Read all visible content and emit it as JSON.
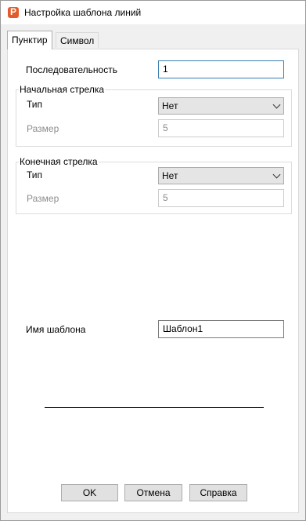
{
  "window": {
    "title": "Настройка шаблона линий",
    "icon_letter": "P"
  },
  "tabs": [
    {
      "label": "Пунктир",
      "active": true
    },
    {
      "label": "Символ",
      "active": false
    }
  ],
  "sequence": {
    "label": "Последовательность",
    "value": "1"
  },
  "start_arrow": {
    "title": "Начальная стрелка",
    "type_label": "Тип",
    "type_value": "Нет",
    "size_label": "Размер",
    "size_value": "5"
  },
  "end_arrow": {
    "title": "Конечная стрелка",
    "type_label": "Тип",
    "type_value": "Нет",
    "size_label": "Размер",
    "size_value": "5"
  },
  "template": {
    "label": "Имя шаблона",
    "value": "Шаблон1"
  },
  "buttons": {
    "ok": "OK",
    "cancel": "Отмена",
    "help": "Справка"
  },
  "colors": {
    "accent": "#3c7fb1",
    "app_icon": "#e35b2a"
  }
}
